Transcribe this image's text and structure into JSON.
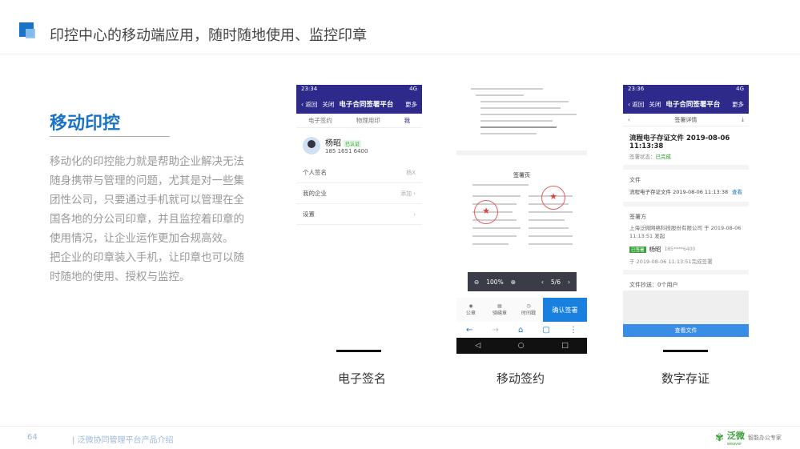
{
  "header": {
    "title": "印控中心的移动端应用，随时随地使用、监控印章"
  },
  "section": {
    "title": "移动印控",
    "desc": [
      "移动化的印控能力就是帮助企业解决无法随身携带与管理的问题，尤其是对一些集团性公司，只要通过手机就可以管理在全国各地的分公司印章，并且监控着印章的使用情况，让企业运作更加合规高效。",
      "把企业的印章装入手机，让印章也可以随时随地的使用、授权与监控。"
    ]
  },
  "phone1": {
    "time": "23:34",
    "signal": "4G",
    "back": "返回",
    "close": "关闭",
    "title": "电子合同签署平台",
    "more": "更多",
    "tabs": [
      "电子签约",
      "物理用印",
      "我"
    ],
    "user_name": "杨昭",
    "user_tag": "已认证",
    "user_phone": "185 1651 6400",
    "rows": [
      {
        "label": "个人签名",
        "right": "杨X"
      },
      {
        "label": "我的企业",
        "right": "添加"
      },
      {
        "label": "设置",
        "right": ""
      }
    ],
    "caption": "电子签名"
  },
  "phone2": {
    "doc_title": "签署页",
    "stamp_char": "★",
    "zoom": "100%",
    "page": "5/6",
    "tools": [
      "公章",
      "骑缝章",
      "时间戳"
    ],
    "confirm": "确认签署",
    "caption": "移动签约"
  },
  "phone3": {
    "time": "23:36",
    "signal": "4G",
    "back": "返回",
    "close": "关闭",
    "title": "电子合同签署平台",
    "more": "更多",
    "sub_title": "签署详情",
    "doc_name": "流程电子存证文件 2019-08-06 11:13:38",
    "status_label": "签署状态：",
    "status_value": "已完成",
    "file_label": "文件",
    "file_name": "流程电子存证文件 2019-08-06 11:13:38",
    "file_view": "查看",
    "signer_label": "签署方",
    "company": "上海泛微网络科技股份有限公司 于 2019-08-06 11:13:51 发起",
    "signer_badge": "已签署",
    "signer_name": "杨昭",
    "signer_mask": "185****6400",
    "signer_time": "于 2019-08-06 11:13:51完成签署",
    "cc": "文件抄送：0个用户",
    "view_btn": "查看文件",
    "caption": "数字存证"
  },
  "footer": {
    "page_no": "64",
    "text": "| 泛微协同管理平台产品介绍",
    "logo_cn": "泛微",
    "logo_en": "weaver",
    "slogan": "智能办公专家"
  }
}
